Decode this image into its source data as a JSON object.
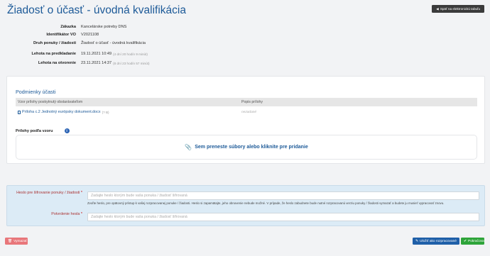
{
  "page": {
    "title": "Žiadosť o účasť - úvodná kvalifikácia",
    "back_button": "Späť na elektronickú tabuľu"
  },
  "info": [
    {
      "label": "Zákazka",
      "value": "Kancelárske potreby DNS",
      "note": ""
    },
    {
      "label": "Identifikátor VO",
      "value": "V2021108",
      "note": ""
    },
    {
      "label": "Druh ponuky / žiadosti",
      "value": "Žiadosť o účasť - úvodná kvalifikácia",
      "note": ""
    },
    {
      "label": "Lehota na predkladanie",
      "value": "19.11.2021 10:49",
      "note": "(4 dní 20 hodín 9 minút)"
    },
    {
      "label": "Lehota na otvorenie",
      "value": "23.11.2021 14:37",
      "note": "(8 dní 23 hodín 57 minút)"
    }
  ],
  "conditions": {
    "title": "Podmienky účasti",
    "columns": [
      "Vzor prílohy poskytnutý obstarávateľom",
      "Popis prílohy"
    ],
    "rows": [
      {
        "file": "Príloha c.2 Jednotný európsky dokument.docx",
        "size": "(? B)",
        "description": "nezadané"
      }
    ],
    "attach_label": "Prílohy podľa vzoru",
    "info_icon": "info-icon",
    "dropzone_text": "Sem preneste súbory alebo kliknite pre pridanie"
  },
  "password": {
    "label1": "Heslo pre šifrovanie ponuky / žiadosti",
    "placeholder1": "Zadajte heslo ktorým bude vaša ponuka / žiadosť šifrovaná",
    "help": "Zvoľte heslo, pre opätovný prístup k vašej rozpracovanej ponuke / žiadosti. Heslo si zapamätajte, jeho obnovenie nebude možné. V prípade, že heslo zabudnete bude nutné rozpracovanú verziu ponuky / žiadosti vymazať a budete ju musieť vypracovať znovu.",
    "label2": "Potvrdenie hesla",
    "placeholder2": "Zadajte heslo ktorým bude vaša ponuka / žiadosť šifrovaná",
    "required_mark": "*"
  },
  "actions": {
    "delete": "Vymazať",
    "save": "Uložiť ako rozpracované",
    "continue": "Pokračovať"
  },
  "colors": {
    "title": "#1d5a98",
    "delete": "#e8767a",
    "save": "#1f5fa8",
    "continue": "#2ea43a"
  }
}
